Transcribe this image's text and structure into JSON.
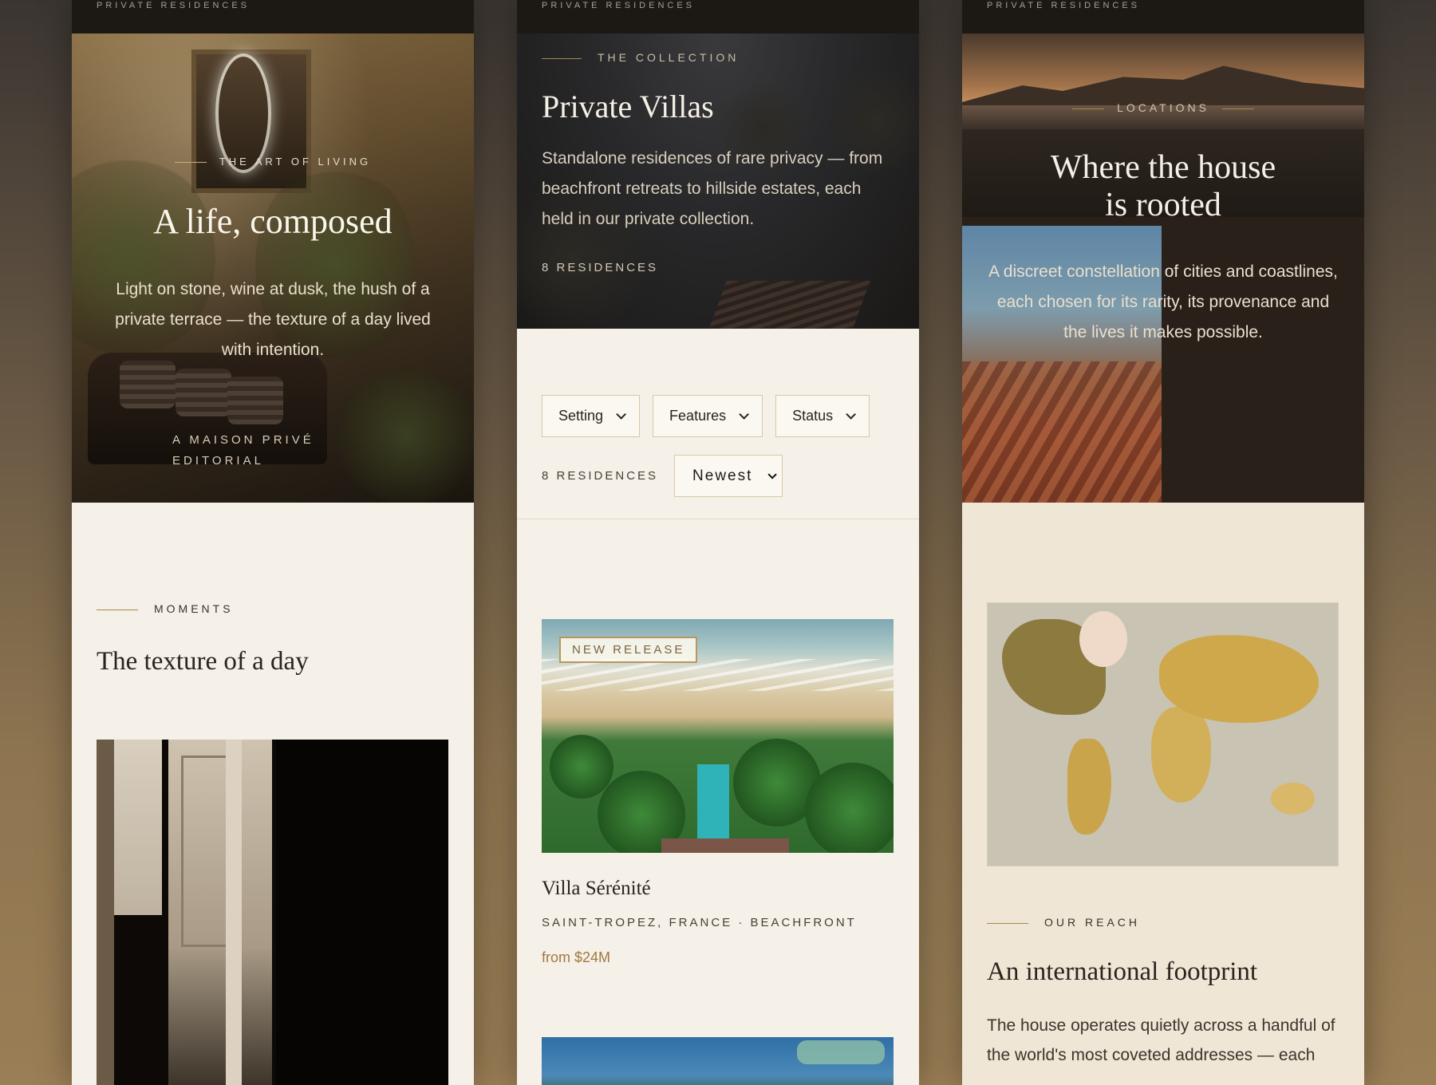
{
  "screens": [
    {
      "brand": "PRIVATE RESIDENCES",
      "hero": {
        "eyebrow": "THE ART OF LIVING",
        "title": "A life, composed",
        "lede": "Light on stone, wine at dusk, the hush of a private terrace — the texture of a day lived with intention.",
        "credit": "A MAISON PRIVÉ EDITORIAL"
      },
      "section": {
        "kicker": "MOMENTS",
        "title": "The texture of a day"
      }
    },
    {
      "brand": "PRIVATE RESIDENCES",
      "hero": {
        "eyebrow": "THE COLLECTION",
        "title": "Private Villas",
        "lede": "Standalone residences of rare privacy — from beachfront retreats to hillside estates, each held in our private collection.",
        "count": "8 RESIDENCES"
      },
      "filters": {
        "items": [
          "Setting",
          "Features",
          "Status"
        ],
        "count": "8 RESIDENCES",
        "sort_value": "Newest"
      },
      "listings": [
        {
          "badge": "NEW RELEASE",
          "name": "Villa Sérénité",
          "location": "SAINT-TROPEZ, FRANCE · BEACHFRONT",
          "price": "from $24M"
        }
      ]
    },
    {
      "brand": "PRIVATE RESIDENCES",
      "hero": {
        "eyebrow": "LOCATIONS",
        "title_line1": "Where the house",
        "title_line2": "is rooted",
        "lede": "A discreet constellation of cities and coastlines, each chosen for its rarity, its provenance and the lives it makes possible."
      },
      "section": {
        "kicker": "OUR REACH",
        "title": "An international footprint",
        "body": "The house operates quietly across a handful of the world's most coveted addresses — each"
      }
    }
  ],
  "colors": {
    "accent_gold": "#a5894f",
    "price": "#a07a3e",
    "cream": "#f5f0e8",
    "ink": "#2b241d"
  }
}
